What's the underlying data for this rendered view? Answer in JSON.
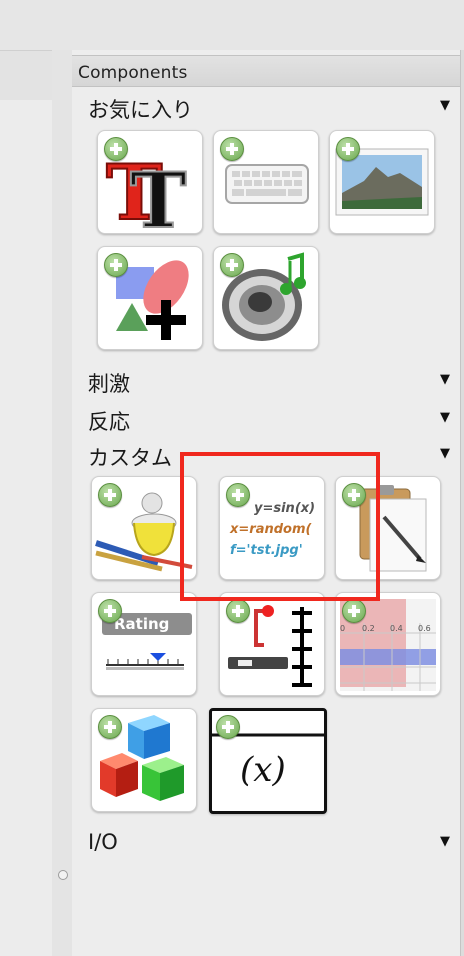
{
  "panel": {
    "title": "Components",
    "sections": [
      {
        "label": "お気に入り",
        "arrow": "▼"
      },
      {
        "label": "刺激",
        "arrow": "▼"
      },
      {
        "label": "反応",
        "arrow": "▼"
      },
      {
        "label": "カスタム",
        "arrow": "▼"
      },
      {
        "label": "I/O",
        "arrow": "▼"
      }
    ]
  },
  "favorites": [
    {
      "icon": "text-component-icon"
    },
    {
      "icon": "keyboard-component-icon"
    },
    {
      "icon": "image-component-icon"
    },
    {
      "icon": "polygon-component-icon"
    },
    {
      "icon": "sound-component-icon"
    }
  ],
  "custom": [
    {
      "icon": "variables-component-icon"
    },
    {
      "icon": "code-component-icon",
      "lines": [
        "y=sin(x)",
        "x=random(",
        "f='tst.jpg'"
      ]
    },
    {
      "icon": "clipboard-component-icon"
    },
    {
      "icon": "rating-component-icon",
      "text": "Rating"
    },
    {
      "icon": "slider-component-icon"
    },
    {
      "icon": "form-component-icon",
      "ticks": [
        "0",
        "0.2",
        "0.4",
        "0.6"
      ]
    },
    {
      "icon": "cubes-component-icon"
    },
    {
      "icon": "function-component-icon",
      "text": "(x)"
    }
  ],
  "colors": {
    "highlight": "#f0281e",
    "plus": "#6aa84f"
  }
}
